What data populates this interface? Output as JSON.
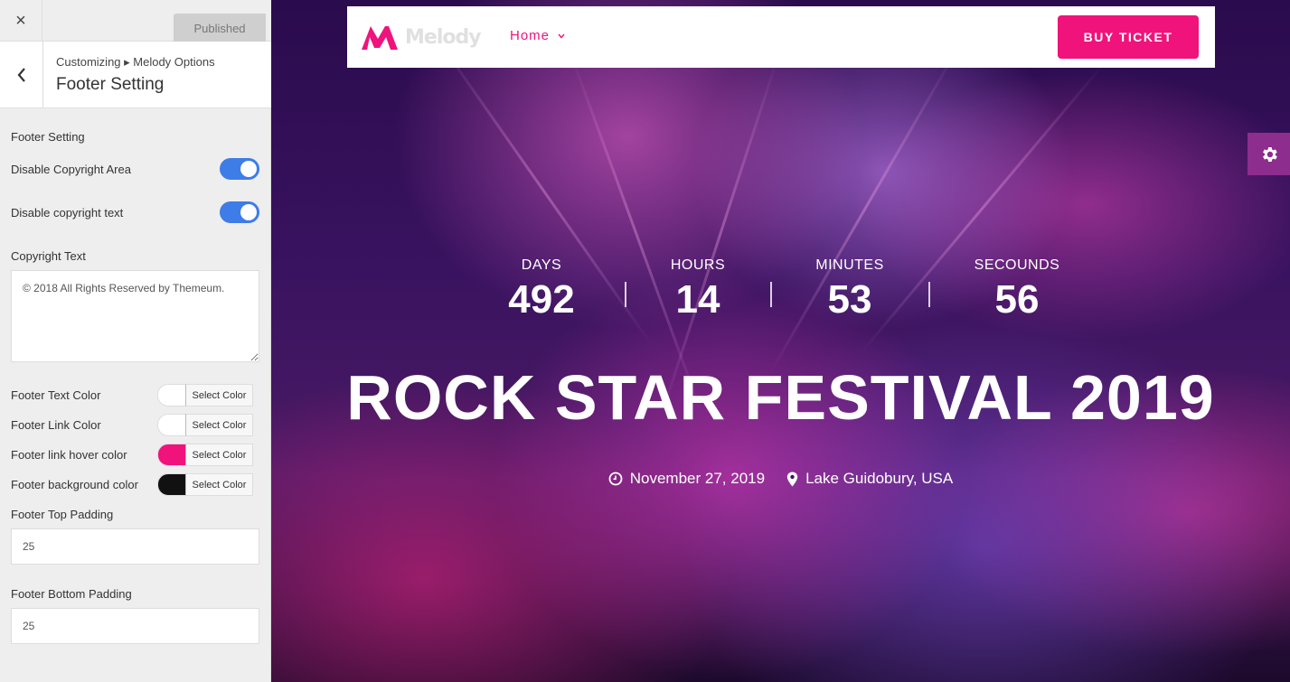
{
  "topbar": {
    "close_label": "×",
    "publish_label": "Published"
  },
  "section": {
    "breadcrumb": "Customizing ▸ Melody Options",
    "title": "Footer Setting",
    "back_label": "‹"
  },
  "controls": {
    "heading": "Footer Setting",
    "disable_copyright_area": {
      "label": "Disable Copyright Area",
      "enabled": true
    },
    "disable_copyright_text": {
      "label": "Disable copyright text",
      "enabled": true
    },
    "copyright_text": {
      "label": "Copyright Text",
      "value": "© 2018 All Rights Reserved by Themeum."
    },
    "colors": [
      {
        "label": "Footer Text Color",
        "button": "Select Color",
        "color": "#ffffff"
      },
      {
        "label": "Footer Link Color",
        "button": "Select Color",
        "color": "#ffffff"
      },
      {
        "label": "Footer link hover color",
        "button": "Select Color",
        "color": "#f0137b"
      },
      {
        "label": "Footer background color",
        "button": "Select Color",
        "color": "#111111"
      }
    ],
    "top_padding": {
      "label": "Footer Top Padding",
      "value": "25"
    },
    "bottom_padding": {
      "label": "Footer Bottom Padding",
      "value": "25"
    }
  },
  "preview": {
    "logo_text": "Melody",
    "nav_home": "Home",
    "buy_ticket": "BUY TICKET",
    "countdown": [
      {
        "label": "DAYS",
        "value": "492"
      },
      {
        "label": "HOURS",
        "value": "14"
      },
      {
        "label": "MINUTES",
        "value": "53"
      },
      {
        "label": "SECOUNDS",
        "value": "56"
      }
    ],
    "headline": "ROCK STAR FESTIVAL 2019",
    "date": "November 27, 2019",
    "location": "Lake Guidobury, USA",
    "accent_color": "#f0137b"
  }
}
